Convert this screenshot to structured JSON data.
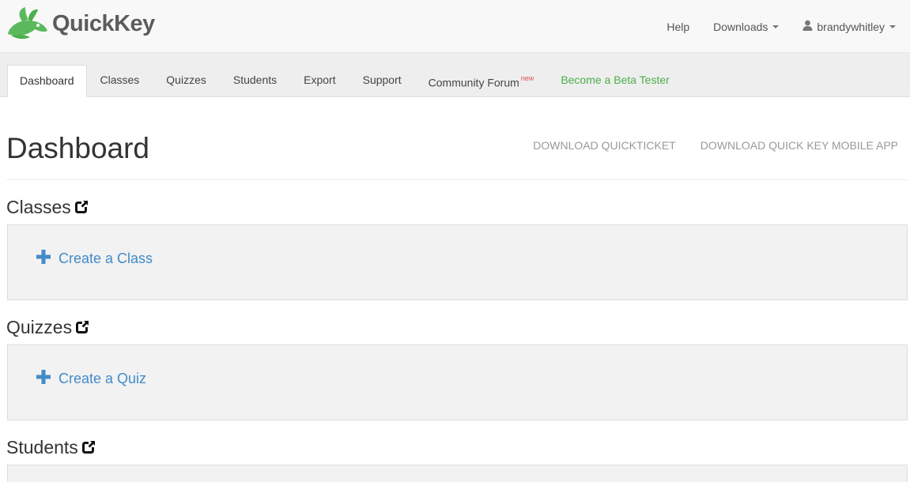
{
  "brand": {
    "name_part1": "Quick",
    "name_part2": "Key",
    "logo_icon": "rabbit-logo-icon",
    "accent_color": "#5cb85c"
  },
  "topnav": {
    "help": "Help",
    "downloads": "Downloads",
    "user": "brandywhitley"
  },
  "tabs": [
    {
      "label": "Dashboard",
      "active": true
    },
    {
      "label": "Classes"
    },
    {
      "label": "Quizzes"
    },
    {
      "label": "Students"
    },
    {
      "label": "Export"
    },
    {
      "label": "Support"
    },
    {
      "label": "Community Forum",
      "badge": "new"
    },
    {
      "label": "Become a Beta Tester"
    }
  ],
  "page": {
    "title": "Dashboard",
    "download_quickticket": "DOWNLOAD QUICKTICKET",
    "download_mobile_app": "DOWNLOAD QUICK KEY MOBILE APP"
  },
  "sections": {
    "classes": {
      "title": "Classes",
      "action": "Create a Class"
    },
    "quizzes": {
      "title": "Quizzes",
      "action": "Create a Quiz"
    },
    "students": {
      "title": "Students"
    }
  },
  "colors": {
    "link": "#428bca",
    "new_badge": "#d9534f",
    "beta": "#4cae4c"
  }
}
